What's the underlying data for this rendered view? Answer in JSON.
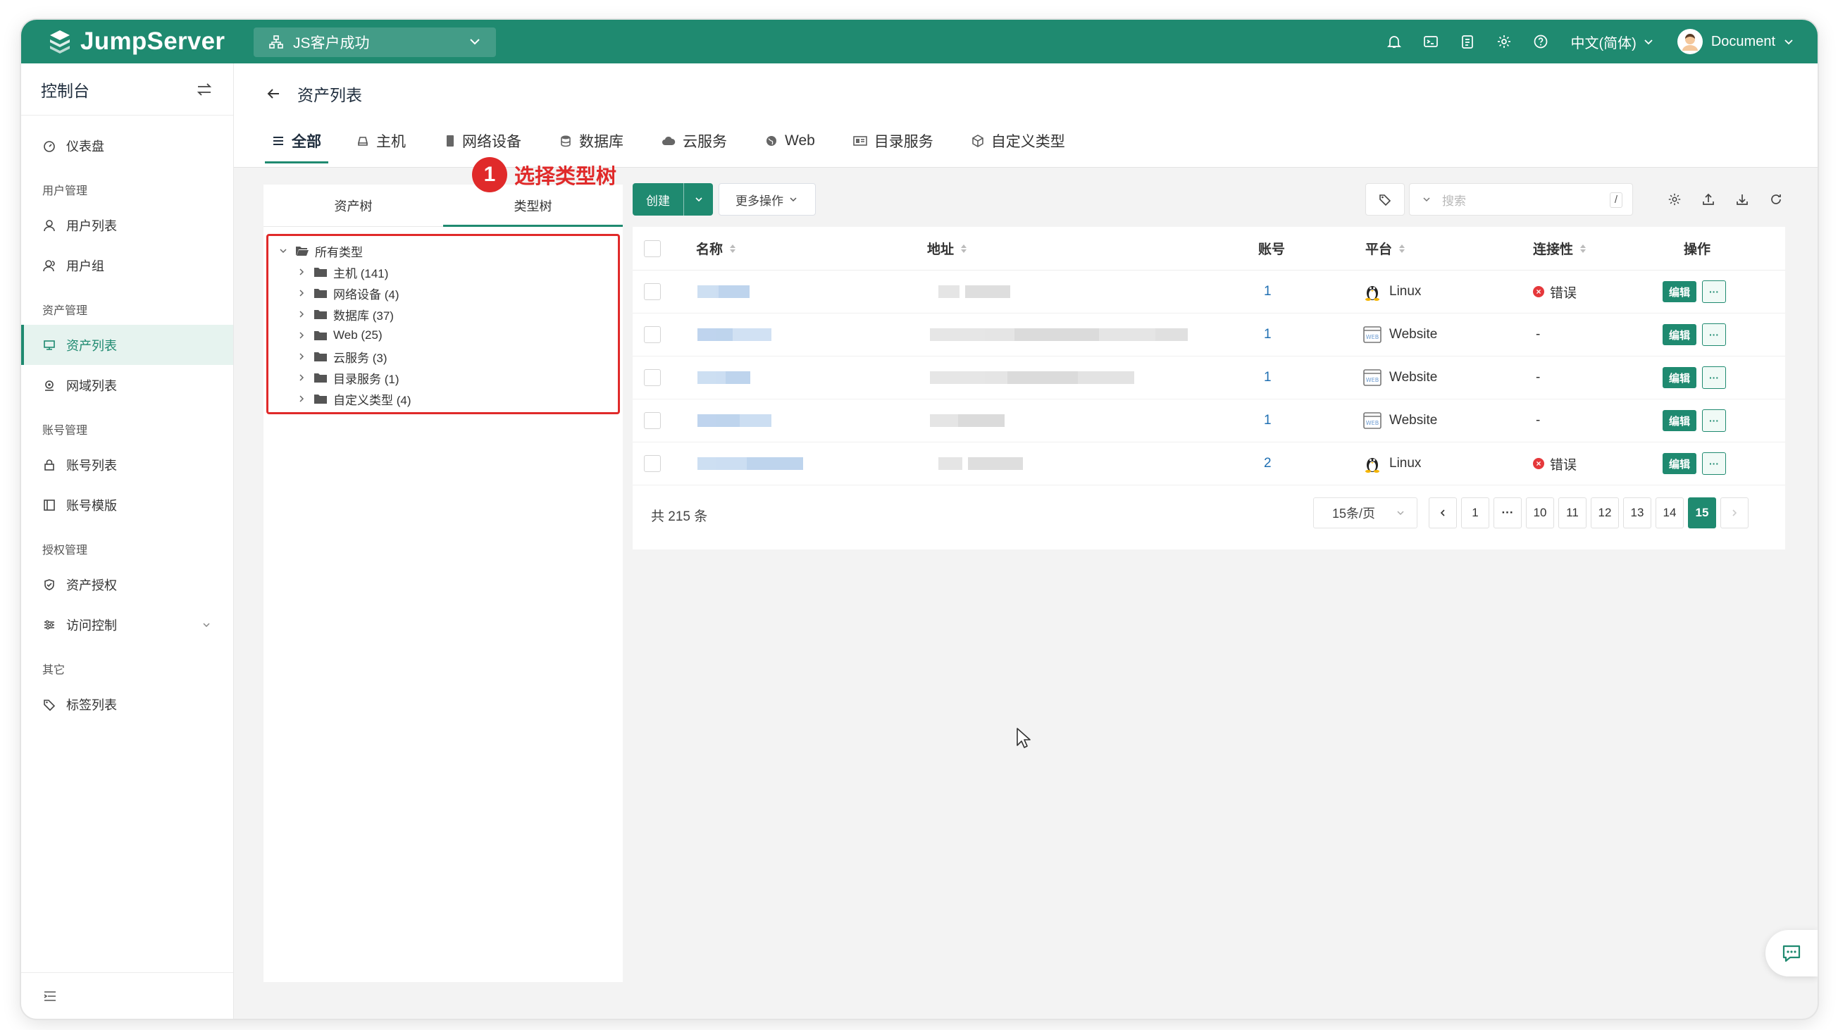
{
  "app": {
    "name": "JumpServer",
    "org": "JS客户成功"
  },
  "topbar": {
    "language": "中文(简体)",
    "user": "Document",
    "icons": [
      "bell-icon",
      "terminal-icon",
      "clipboard-icon",
      "gear-icon",
      "help-icon"
    ]
  },
  "sidebar": {
    "title": "控制台",
    "groups": [
      {
        "label": "",
        "items": [
          {
            "label": "仪表盘",
            "icon": "dashboard-icon"
          }
        ]
      },
      {
        "label": "用户管理",
        "items": [
          {
            "label": "用户列表",
            "icon": "user-icon"
          },
          {
            "label": "用户组",
            "icon": "user-group-icon"
          }
        ]
      },
      {
        "label": "资产管理",
        "items": [
          {
            "label": "资产列表",
            "icon": "asset-list-icon",
            "active": true
          },
          {
            "label": "网域列表",
            "icon": "zone-icon"
          }
        ]
      },
      {
        "label": "账号管理",
        "items": [
          {
            "label": "账号列表",
            "icon": "lock-icon"
          },
          {
            "label": "账号模版",
            "icon": "template-icon"
          }
        ]
      },
      {
        "label": "授权管理",
        "items": [
          {
            "label": "资产授权",
            "icon": "shield-icon"
          },
          {
            "label": "访问控制",
            "icon": "access-control-icon",
            "expandable": true
          }
        ]
      },
      {
        "label": "其它",
        "items": [
          {
            "label": "标签列表",
            "icon": "tag-icon"
          }
        ]
      }
    ]
  },
  "page": {
    "title": "资产列表"
  },
  "tabs": [
    {
      "label": "全部",
      "icon": "list-icon",
      "active": true
    },
    {
      "label": "主机",
      "icon": "host-icon"
    },
    {
      "label": "网络设备",
      "icon": "network-device-icon"
    },
    {
      "label": "数据库",
      "icon": "database-icon"
    },
    {
      "label": "云服务",
      "icon": "cloud-icon"
    },
    {
      "label": "Web",
      "icon": "globe-icon"
    },
    {
      "label": "目录服务",
      "icon": "directory-icon"
    },
    {
      "label": "自定义类型",
      "icon": "cube-icon"
    }
  ],
  "left_panel": {
    "tabs": [
      "资产树",
      "类型树"
    ],
    "active_tab": "类型树",
    "tree_root": "所有类型",
    "tree_children": [
      "主机 (141)",
      "网络设备 (4)",
      "数据库 (37)",
      "Web (25)",
      "云服务 (3)",
      "目录服务 (1)",
      "自定义类型 (4)"
    ]
  },
  "callout": {
    "number": "1",
    "text": "选择类型树"
  },
  "toolbar": {
    "create_label": "创建",
    "more_label": "更多操作",
    "search_placeholder": "搜索",
    "search_kbd": "/"
  },
  "table": {
    "columns": {
      "name": "名称",
      "address": "地址",
      "accounts": "账号",
      "platform": "平台",
      "connectivity": "连接性",
      "actions": "操作"
    },
    "rows": [
      {
        "accounts": "1",
        "platform": "Linux",
        "platform_icon": "linux-icon",
        "connectivity": "错误",
        "connectivity_status": "error"
      },
      {
        "accounts": "1",
        "platform": "Website",
        "platform_icon": "website-icon",
        "connectivity": "-",
        "connectivity_status": "unknown"
      },
      {
        "accounts": "1",
        "platform": "Website",
        "platform_icon": "website-icon",
        "connectivity": "-",
        "connectivity_status": "unknown"
      },
      {
        "accounts": "1",
        "platform": "Website",
        "platform_icon": "website-icon",
        "connectivity": "-",
        "connectivity_status": "unknown"
      },
      {
        "accounts": "2",
        "platform": "Linux",
        "platform_icon": "linux-icon",
        "connectivity": "错误",
        "connectivity_status": "error"
      }
    ],
    "edit_label": "编辑",
    "more_label": "···"
  },
  "pagination": {
    "total": "共 215 条",
    "page_size": "15条/页",
    "pages": [
      "1",
      "···",
      "10",
      "11",
      "12",
      "13",
      "14",
      "15"
    ],
    "current": "15"
  },
  "colors": {
    "brand": "#1f8a70",
    "error": "#e5383b",
    "callout": "#e02a2a",
    "link": "#1f6fb2"
  }
}
